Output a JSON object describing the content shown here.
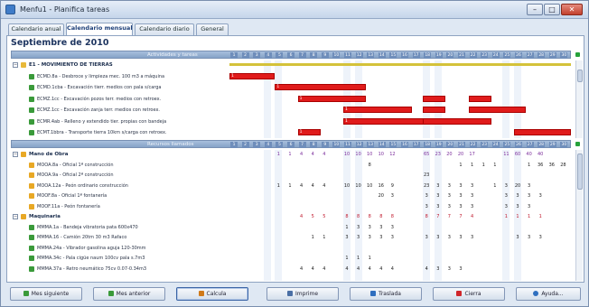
{
  "window": {
    "title": "Menfu1 - Planifica tareas"
  },
  "tabs": [
    {
      "label": "Calendario anual"
    },
    {
      "label": "Calendario mensual"
    },
    {
      "label": "Calendario diario"
    },
    {
      "label": "General"
    }
  ],
  "month_title": "Septiembre de 2010",
  "activities": {
    "header_label": "Actividades y tareas",
    "days": [
      "1",
      "2",
      "3",
      "4",
      "5",
      "6",
      "7",
      "8",
      "9",
      "10",
      "11",
      "12",
      "13",
      "14",
      "15",
      "16",
      "17",
      "18",
      "19",
      "20",
      "21",
      "22",
      "23",
      "24",
      "25",
      "26",
      "27",
      "28",
      "29",
      "30"
    ],
    "rows": [
      {
        "label": "E1 - MOVIMIENTO DE TIERRAS"
      },
      {
        "label": "ECMD.8a - Desbroce y limpieza mec. 100 m3 a máquina",
        "bar_text": "1"
      },
      {
        "label": "ECMD.1cba - Excavación tierr. medios con pala s/carga",
        "bar_text": "1"
      },
      {
        "label": "ECMZ.1cc - Excavación pozos terr. medios con retroex.",
        "bar_text": "1"
      },
      {
        "label": "ECMZ.1cc - Excavación zanja terr. medios con retroex.",
        "bar_text": "1"
      },
      {
        "label": "ECMR.4ab - Relleno y extendido tier. propias con bandeja",
        "bar_text": "1"
      },
      {
        "label": "ECMT.1bbra - Transporte tierra 10km s/carga con retroex.",
        "bar_text": "1"
      }
    ]
  },
  "resources": {
    "header_label": "Recursos llamados",
    "rows": [
      {
        "label": "Mano de Obra",
        "group": true,
        "values": []
      },
      {
        "label": "MOOA.8a - Oficial 1ª construcción",
        "values": [
          {
            "d": "13",
            "v": "8"
          },
          {
            "d": "21",
            "v": "1"
          },
          {
            "d": "22",
            "v": "1"
          },
          {
            "d": "23",
            "v": "1"
          },
          {
            "d": "24",
            "v": "1"
          },
          {
            "d": "27",
            "v": "1"
          },
          {
            "d": "28",
            "v": "36"
          },
          {
            "d": "29",
            "v": "36"
          },
          {
            "d": "30",
            "v": "28"
          }
        ]
      },
      {
        "label": "MOOA.9a - Oficial 2ª construcción",
        "values": [
          {
            "d": "18",
            "v": "23"
          }
        ]
      },
      {
        "label": "MOOA.12a - Peón ordinario construcción",
        "values": [
          {
            "d": "5",
            "v": "1"
          },
          {
            "d": "6",
            "v": "1"
          },
          {
            "d": "7",
            "v": "4"
          },
          {
            "d": "8",
            "v": "4"
          },
          {
            "d": "9",
            "v": "4"
          },
          {
            "d": "11",
            "v": "10"
          },
          {
            "d": "12",
            "v": "10"
          },
          {
            "d": "13",
            "v": "10"
          },
          {
            "d": "14",
            "v": "16"
          },
          {
            "d": "15",
            "v": "9"
          },
          {
            "d": "18",
            "v": "23"
          },
          {
            "d": "19",
            "v": "3"
          },
          {
            "d": "20",
            "v": "3"
          },
          {
            "d": "21",
            "v": "3"
          },
          {
            "d": "22",
            "v": "3"
          },
          {
            "d": "24",
            "v": "1"
          },
          {
            "d": "25",
            "v": "3"
          },
          {
            "d": "26",
            "v": "20"
          },
          {
            "d": "27",
            "v": "3"
          }
        ]
      },
      {
        "label": "MOOF.8a - Oficial 1ª fontanería",
        "values": [
          {
            "d": "14",
            "v": "20"
          },
          {
            "d": "15",
            "v": "3"
          },
          {
            "d": "18",
            "v": "3"
          },
          {
            "d": "19",
            "v": "3"
          },
          {
            "d": "20",
            "v": "3"
          },
          {
            "d": "21",
            "v": "3"
          },
          {
            "d": "22",
            "v": "3"
          },
          {
            "d": "25",
            "v": "3"
          },
          {
            "d": "26",
            "v": "3"
          },
          {
            "d": "27",
            "v": "3"
          },
          {
            "d": "28",
            "v": "3"
          }
        ]
      },
      {
        "label": "MOOF.11a - Peón fontanería",
        "values": [
          {
            "d": "18",
            "v": "3"
          },
          {
            "d": "19",
            "v": "3"
          },
          {
            "d": "20",
            "v": "3"
          },
          {
            "d": "21",
            "v": "3"
          },
          {
            "d": "22",
            "v": "3"
          },
          {
            "d": "25",
            "v": "3"
          },
          {
            "d": "26",
            "v": "3"
          },
          {
            "d": "27",
            "v": "3"
          }
        ]
      },
      {
        "label": "Maquinaria",
        "group": true,
        "values": []
      },
      {
        "label": "MMMA.1a - Bandeja vibratoria pata 600x470",
        "values": [
          {
            "d": "11",
            "v": "1"
          },
          {
            "d": "12",
            "v": "3"
          },
          {
            "d": "13",
            "v": "3"
          },
          {
            "d": "14",
            "v": "3"
          },
          {
            "d": "15",
            "v": "3"
          }
        ]
      },
      {
        "label": "MMMA.16 - Camión 20tm 30 m3 Rafaco",
        "values": [
          {
            "d": "8",
            "v": "1"
          },
          {
            "d": "9",
            "v": "1"
          },
          {
            "d": "11",
            "v": "3"
          },
          {
            "d": "12",
            "v": "3"
          },
          {
            "d": "13",
            "v": "3"
          },
          {
            "d": "14",
            "v": "3"
          },
          {
            "d": "15",
            "v": "3"
          },
          {
            "d": "18",
            "v": "3"
          },
          {
            "d": "19",
            "v": "3"
          },
          {
            "d": "20",
            "v": "3"
          },
          {
            "d": "21",
            "v": "3"
          },
          {
            "d": "22",
            "v": "3"
          },
          {
            "d": "26",
            "v": "3"
          },
          {
            "d": "27",
            "v": "3"
          },
          {
            "d": "28",
            "v": "3"
          }
        ]
      },
      {
        "label": "MMMA.24a - Vibrador gasolina aguja 120-30mm",
        "values": []
      },
      {
        "label": "MMMA.34c - Pala cigüe naum 100cv pala s.7m3",
        "values": [
          {
            "d": "11",
            "v": "1"
          },
          {
            "d": "12",
            "v": "1"
          },
          {
            "d": "13",
            "v": "1"
          }
        ]
      },
      {
        "label": "MMMA.37a - Retro neumático 75cv 0.07-0.34m3",
        "values": [
          {
            "d": "7",
            "v": "4"
          },
          {
            "d": "8",
            "v": "4"
          },
          {
            "d": "9",
            "v": "4"
          },
          {
            "d": "11",
            "v": "4"
          },
          {
            "d": "12",
            "v": "4"
          },
          {
            "d": "13",
            "v": "4"
          },
          {
            "d": "14",
            "v": "4"
          },
          {
            "d": "15",
            "v": "4"
          },
          {
            "d": "18",
            "v": "4"
          },
          {
            "d": "19",
            "v": "3"
          },
          {
            "d": "20",
            "v": "3"
          },
          {
            "d": "21",
            "v": "3"
          }
        ]
      }
    ],
    "mo_totals": [
      {
        "d": "5",
        "v": "1"
      },
      {
        "d": "6",
        "v": "1"
      },
      {
        "d": "7",
        "v": "4"
      },
      {
        "d": "8",
        "v": "4"
      },
      {
        "d": "9",
        "v": "4"
      },
      {
        "d": "11",
        "v": "10"
      },
      {
        "d": "12",
        "v": "10"
      },
      {
        "d": "13",
        "v": "10"
      },
      {
        "d": "14",
        "v": "10"
      },
      {
        "d": "15",
        "v": "12"
      },
      {
        "d": "18",
        "v": "65"
      },
      {
        "d": "19",
        "v": "23"
      },
      {
        "d": "20",
        "v": "20"
      },
      {
        "d": "21",
        "v": "20"
      },
      {
        "d": "22",
        "v": "17"
      },
      {
        "d": "25",
        "v": "11"
      },
      {
        "d": "26",
        "v": "60"
      },
      {
        "d": "27",
        "v": "40"
      },
      {
        "d": "28",
        "v": "40"
      }
    ],
    "maq_totals": [
      {
        "d": "7",
        "v": "4"
      },
      {
        "d": "8",
        "v": "5"
      },
      {
        "d": "9",
        "v": "5"
      },
      {
        "d": "11",
        "v": "8"
      },
      {
        "d": "12",
        "v": "8"
      },
      {
        "d": "13",
        "v": "8"
      },
      {
        "d": "14",
        "v": "8"
      },
      {
        "d": "15",
        "v": "8"
      },
      {
        "d": "18",
        "v": "8"
      },
      {
        "d": "19",
        "v": "7"
      },
      {
        "d": "20",
        "v": "7"
      },
      {
        "d": "21",
        "v": "7"
      },
      {
        "d": "22",
        "v": "4"
      },
      {
        "d": "25",
        "v": "1"
      },
      {
        "d": "26",
        "v": "1"
      },
      {
        "d": "27",
        "v": "1"
      },
      {
        "d": "28",
        "v": "1"
      }
    ]
  },
  "footer": {
    "buttons": [
      {
        "label": "Mes siguiente"
      },
      {
        "label": "Mes anterior"
      },
      {
        "label": "Calcula"
      },
      {
        "label": "Imprime"
      },
      {
        "label": "Traslada"
      },
      {
        "label": "Cierra"
      },
      {
        "label": "Ayuda..."
      }
    ]
  },
  "colors": {
    "bar": "#e01b1b",
    "summary_bar": "#d4c23a",
    "header": "#86a3c8",
    "resource_group": "#e8a825",
    "task": "#3a9a3a"
  }
}
